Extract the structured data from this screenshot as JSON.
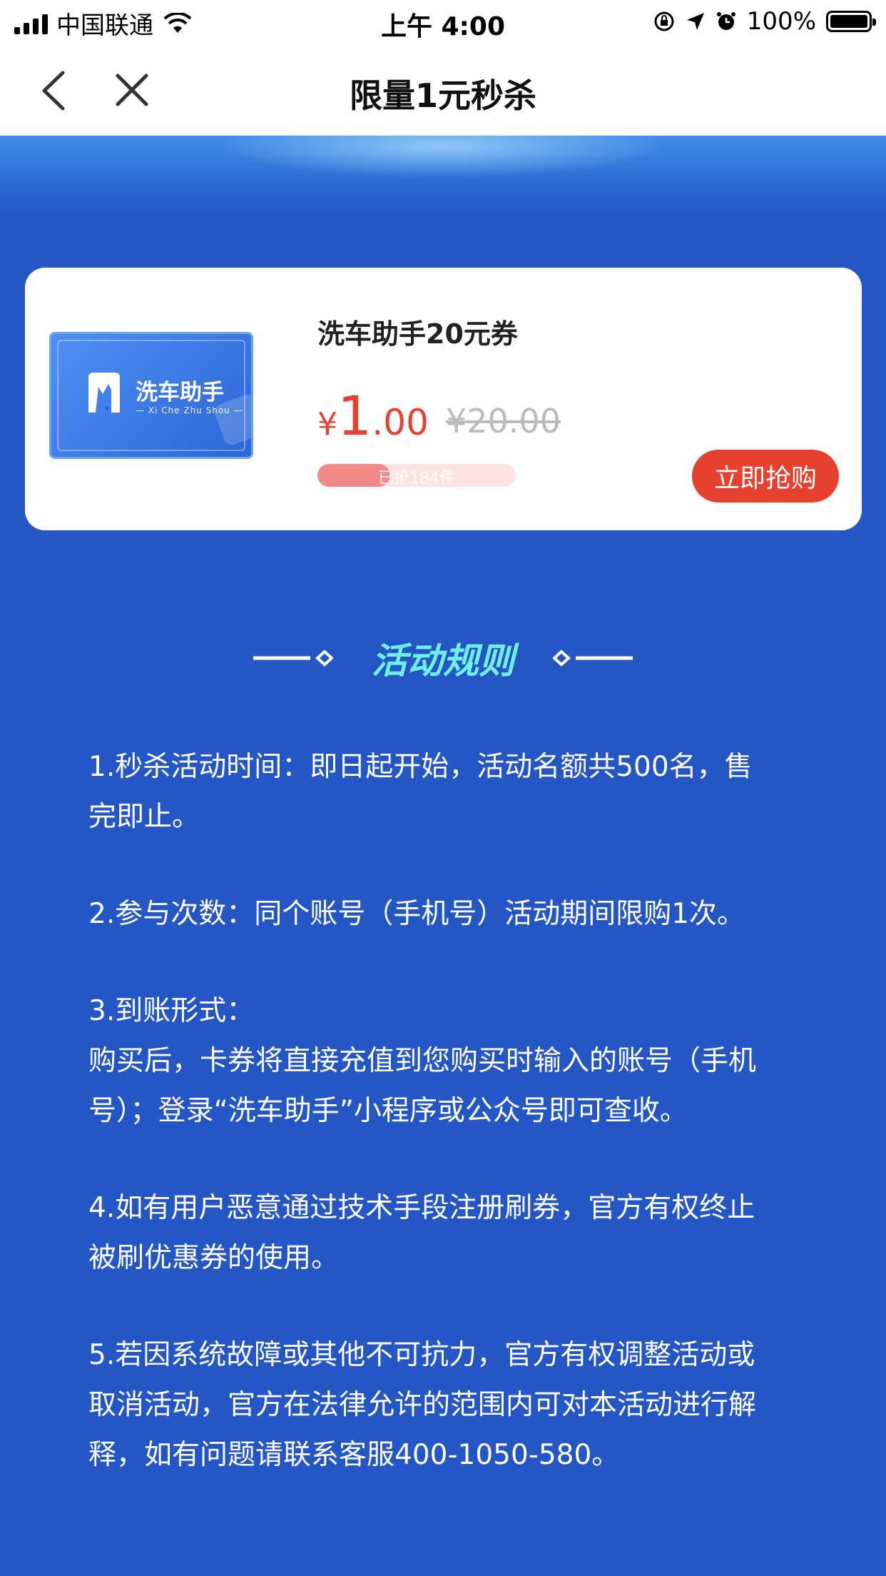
{
  "status_bar": {
    "carrier": "中国联通",
    "time": "上午 4:00",
    "battery": "100%"
  },
  "nav": {
    "title": "限量1元秒杀"
  },
  "product": {
    "thumb_name": "洗车助手",
    "thumb_subtitle": "— Xi Che Zhu Shou —",
    "title": "洗车助手20元券",
    "currency": "¥",
    "price_int": "1",
    "price_dec": ".00",
    "original_price": "¥20.00",
    "sold_label": "已抢184件",
    "sold_fraction": 0.368,
    "buy_label": "立即抢购"
  },
  "rules": {
    "title": "活动规则",
    "items": [
      {
        "lines": [
          "1.秒杀活动时间：即日起开始，活动名额共500名，售",
          "完即止。"
        ]
      },
      {
        "lines": [
          "2.参与次数：同个账号（手机号）活动期间限购1次。"
        ]
      },
      {
        "lines": [
          "3.到账形式：",
          "购买后，卡券将直接充值到您购买时输入的账号（手机",
          "号）；登录“洗车助手”小程序或公众号即可查收。"
        ]
      },
      {
        "lines": [
          "4.如有用户恶意通过技术手段注册刷券，官方有权终止",
          "被刷优惠券的使用。"
        ]
      },
      {
        "lines": [
          "5.若因系统故障或其他不可抗力，官方有权调整活动或",
          "取消活动，官方在法律允许的范围内可对本活动进行解",
          "释，如有问题请联系客服400-1050-580。"
        ]
      }
    ]
  },
  "colors": {
    "page_bg": "#2457c5",
    "accent_red": "#e8402f",
    "rules_title": "#6ff0e6"
  }
}
